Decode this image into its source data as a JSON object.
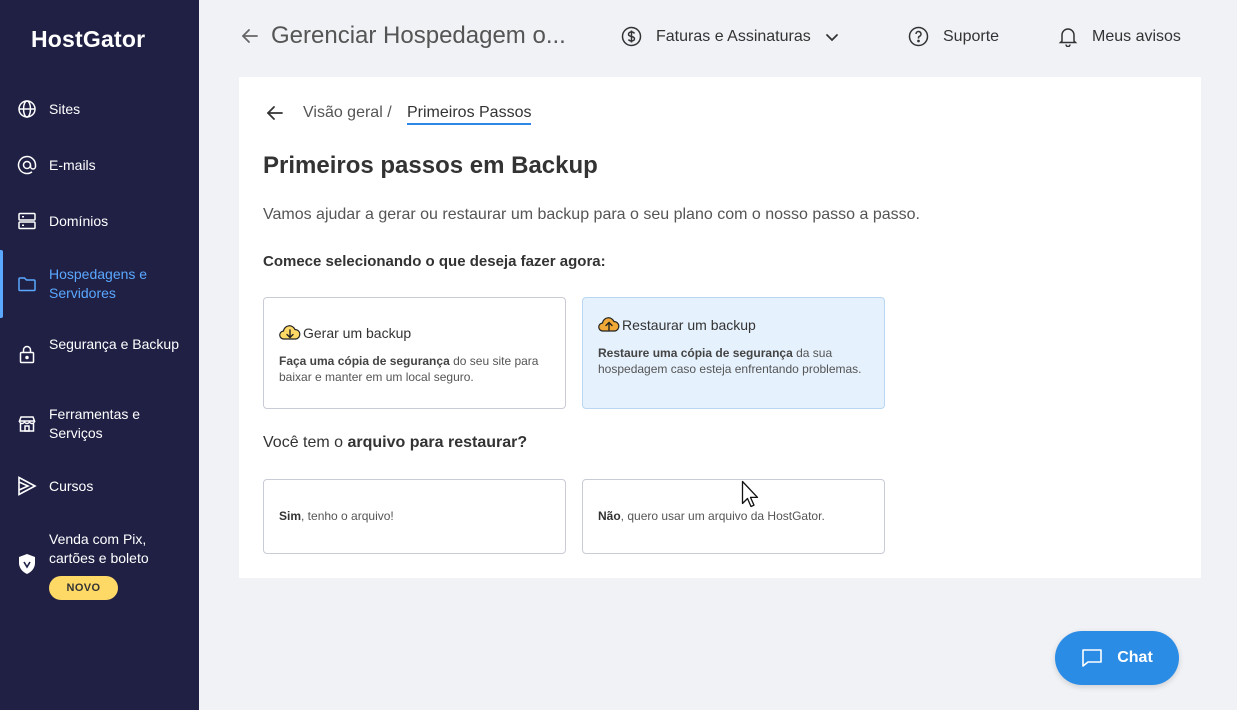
{
  "sidebar": {
    "logo": "HostGator",
    "items": [
      {
        "label": "Sites",
        "icon": "globe-icon"
      },
      {
        "label": "E-mails",
        "icon": "at-icon"
      },
      {
        "label": "Domínios",
        "icon": "server-icon"
      },
      {
        "label": "Hospedagens e Servidores",
        "icon": "folder-icon",
        "active": true
      },
      {
        "label": "Segurança e Backup",
        "icon": "lock-icon"
      },
      {
        "label": "Ferramentas e Serviços",
        "icon": "store-icon"
      },
      {
        "label": "Cursos",
        "icon": "play-icon"
      },
      {
        "label": "Venda com Pix, cartões e boleto",
        "icon": "shield-icon"
      }
    ],
    "new_badge": "NOVO"
  },
  "topbar": {
    "title": "Gerenciar Hospedagem o...",
    "billing": "Faturas e Assinaturas",
    "support": "Suporte",
    "notices": "Meus avisos"
  },
  "breadcrumb": {
    "parent": "Visão geral /",
    "current": "Primeiros Passos"
  },
  "main": {
    "title": "Primeiros passos em Backup",
    "intro": "Vamos ajudar a gerar ou restaurar um backup para o seu plano com o nosso passo a passo.",
    "prompt": "Comece selecionando o que deseja fazer agora:",
    "options": [
      {
        "title": "Gerar um backup",
        "desc_bold": "Faça uma cópia de segurança",
        "desc_rest": " do seu site para baixar e manter em um local seguro."
      },
      {
        "title": "Restaurar um backup",
        "desc_bold": "Restaure uma cópia de segurança",
        "desc_rest": " da sua hospedagem caso esteja enfrentando problemas."
      }
    ],
    "file_question_pre": "Você tem o ",
    "file_question_bold": "arquivo para restaurar?",
    "answers": [
      {
        "bold": "Sim",
        "rest": ", tenho o arquivo!"
      },
      {
        "bold": "Não",
        "rest": ", quero usar um arquivo da HostGator."
      }
    ]
  },
  "chat": {
    "label": "Chat"
  },
  "colors": {
    "sidebar_bg": "#1f2044",
    "accent": "#2b8ce6",
    "active": "#5aa8ff",
    "badge": "#ffd966",
    "selected_bg": "#e5f1fc"
  }
}
